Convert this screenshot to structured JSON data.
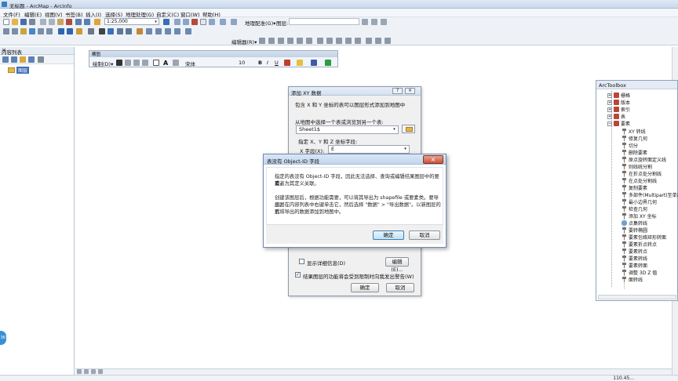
{
  "window": {
    "title": "无标题 - ArcMap - ArcInfo"
  },
  "menu": [
    "文件(F)",
    "编辑(E)",
    "视图(V)",
    "书签(B)",
    "插入(I)",
    "选择(S)",
    "地理处理(G)",
    "自定义(C)",
    "窗口(W)",
    "帮助(H)"
  ],
  "toolbar": {
    "scale": "1:25,000",
    "georef_label": "地理配准(G)▾",
    "layer_label": "图层:",
    "editor_label": "编辑器(R)▾"
  },
  "toc": {
    "title": "内容列表",
    "layer": "图层"
  },
  "drawing": {
    "title": "绘图",
    "draw_label": "绘制(D)▾",
    "font": "宋体",
    "size": "10",
    "bold": "B",
    "italic": "I",
    "underline": "U"
  },
  "toolbox": {
    "title": "ArcToolbox",
    "groups": [
      "栅格",
      "版本",
      "索引",
      "表",
      "要素"
    ],
    "tools": [
      "XY 转线",
      "修复几何",
      "切分",
      "删除要素",
      "原点旋转面定义线",
      "则线统分割",
      "在折点处分割线",
      "在点处分割线",
      "复制要素",
      "多部件(Multipart)至单部",
      "最小边界几何",
      "检查几何",
      "添加 XY 坐标",
      "点集转线",
      "要转椭圆",
      "要素包络矩形转面",
      "要素折点转点",
      "要素转点",
      "要素转线",
      "要素转面",
      "调整 3D Z 值",
      "面转线"
    ]
  },
  "add_xy_dialog": {
    "title": "添加 XY 数据",
    "intro": "包含 X 和 Y 坐标的表可以图层形式添加到地图中",
    "choose_label": "从地图中选择一个表或浏览到另一个表:",
    "table_value": "Sheet1$",
    "fields_label": "指定 X、Y 和 Z 坐标字段:",
    "x_label": "X 字段(X):",
    "x_value": "E",
    "show_details": "显示详细信息(D)",
    "edit_button": "编辑(E)...",
    "warn_label": "结果图层的功能将会受到限制时向我发出警告(W)",
    "ok": "确定",
    "cancel": "取消"
  },
  "message": {
    "title": "表没有 Object-ID 字段",
    "para1": [
      "指定的表没有 Object-ID 字段，因此无法选择、查询或编辑结果图层中的要素，",
      "或者为其定义关联。"
    ],
    "para2": [
      "创建该图层后，根据功能需要，可以将其导出为 shapefile 或要素类。要导出图",
      "层，在内容列表中右键单击它，然后选择 \"数据\" > \"导出数据\"。以新图层的形",
      "式将导出的数据添加到地图中。"
    ],
    "ok": "确定",
    "cancel": "取消"
  },
  "status": {
    "coords": "110.45..."
  },
  "sidetab": {
    "label": "36"
  }
}
